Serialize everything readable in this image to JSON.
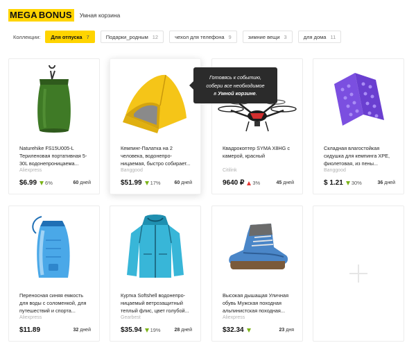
{
  "header": {
    "logo_left": "MEGA",
    "logo_right": "BONUS",
    "subtitle": "Умная корзина"
  },
  "collections": {
    "label": "Коллекции:",
    "chips": [
      {
        "label": "Для отпуска",
        "count": "7",
        "active": true
      },
      {
        "label": "Подарки_родным",
        "count": "12"
      },
      {
        "label": "чехол для телефона",
        "count": "9"
      },
      {
        "label": "зимние вещи",
        "count": "3"
      },
      {
        "label": "для дома",
        "count": "11"
      }
    ]
  },
  "tooltip": {
    "line1": "Готовясь к событию,",
    "line2": "собери все необходимое",
    "line3_prefix": "в ",
    "line3_bold": "Умной корзине",
    "line3_suffix": "."
  },
  "products": [
    {
      "title": "Naturehike FS15U005-L Териленовая портативная 5-30L водонепроницаема...",
      "store": "Aliexpress",
      "price": "$6.99",
      "change": "6%",
      "trend": "down",
      "days_num": "60",
      "days_unit": "дней",
      "icon": "dry-bag"
    },
    {
      "title": "Кемпинг-Палатка на 2 человека, водонепро-ницаемая, быстро собирает...",
      "store": "Banggood",
      "price": "$51.99",
      "change": "17%",
      "trend": "down",
      "days_num": "60",
      "days_unit": "дней",
      "icon": "tent"
    },
    {
      "title": "Квадрокоптер SYMA X8HG с камерой, красный",
      "store": "Citilink",
      "price": "9640 ₽",
      "change": "3%",
      "trend": "up",
      "days_num": "45",
      "days_unit": "дней",
      "icon": "drone"
    },
    {
      "title": "Складная влагостойкая сидушка для кемпинга XPE, фиолетовая, из пены...",
      "store": "Banggood",
      "price": "$ 1.21",
      "change": "30%",
      "trend": "down",
      "days_num": "36",
      "days_unit": "дней",
      "icon": "foam-seat"
    },
    {
      "title": "Переносная синяя емкость для воды с соломенкой, для путешествий и спорта...",
      "store": "Aliexpress",
      "price": "$11.89",
      "change": "",
      "trend": "none",
      "days_num": "32",
      "days_unit": "дней",
      "icon": "hydration-bladder"
    },
    {
      "title": "Куртка Softshell водонепро-ницаемый ветрозащитный теплый флис, цвет голубой...",
      "store": "Gearbest",
      "price": "$35.94",
      "change": "19%",
      "trend": "down",
      "days_num": "28",
      "days_unit": "дней",
      "icon": "jacket"
    },
    {
      "title": "Высокая дышащая Уличная обувь Мужская походная альпинистская походная...",
      "store": "Aliexpress",
      "price": "$32.34",
      "change": "",
      "trend": "down",
      "days_num": "23",
      "days_unit": "дня",
      "icon": "hiking-boot"
    }
  ],
  "colors": {
    "accent": "#ffd400",
    "down": "#7ab317",
    "up": "#e53935",
    "tooltip_bg": "#2b2b2b"
  }
}
